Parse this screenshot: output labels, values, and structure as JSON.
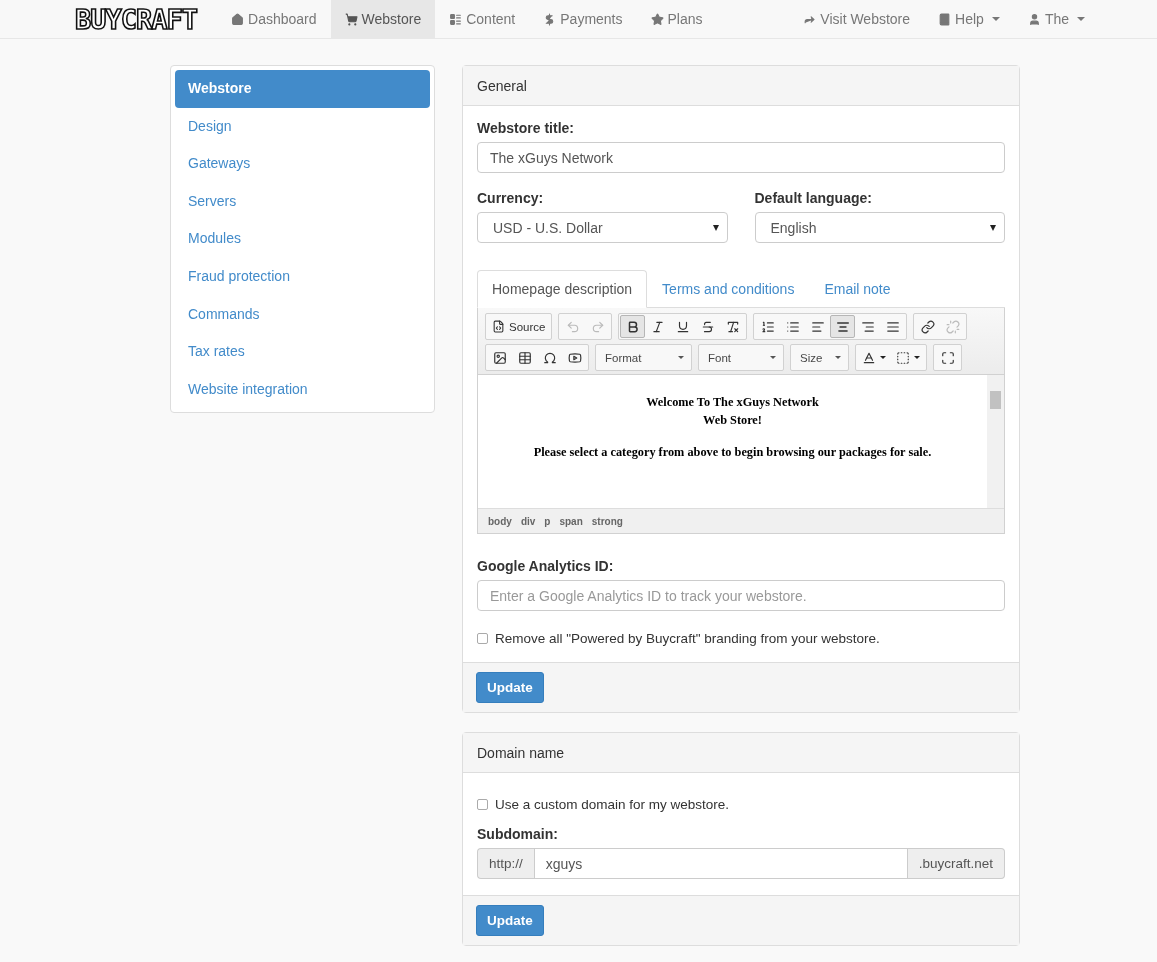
{
  "navbar": {
    "logo": "BUYCRAFT",
    "items": [
      {
        "label": "Dashboard",
        "selected": false
      },
      {
        "label": "Webstore",
        "selected": true
      },
      {
        "label": "Content",
        "selected": false
      },
      {
        "label": "Payments",
        "selected": false
      },
      {
        "label": "Plans",
        "selected": false
      }
    ],
    "right_items": [
      {
        "label": "Visit Webstore",
        "dropdown": false
      },
      {
        "label": "Help",
        "dropdown": true
      },
      {
        "label": "The",
        "dropdown": true
      }
    ]
  },
  "sidebar": {
    "items": [
      {
        "label": "Webstore",
        "selected": true
      },
      {
        "label": "Design",
        "selected": false
      },
      {
        "label": "Gateways",
        "selected": false
      },
      {
        "label": "Servers",
        "selected": false
      },
      {
        "label": "Modules",
        "selected": false
      },
      {
        "label": "Fraud protection",
        "selected": false
      },
      {
        "label": "Commands",
        "selected": false
      },
      {
        "label": "Tax rates",
        "selected": false
      },
      {
        "label": "Website integration",
        "selected": false
      }
    ]
  },
  "general_panel": {
    "title": "General",
    "webstore_title": {
      "label": "Webstore title:",
      "value": "The xGuys Network"
    },
    "currency": {
      "label": "Currency:",
      "value": "USD - U.S. Dollar"
    },
    "default_language": {
      "label": "Default language:",
      "value": "English"
    },
    "tabs": [
      {
        "label": "Homepage description",
        "selected": true
      },
      {
        "label": "Terms and conditions",
        "selected": false
      },
      {
        "label": "Email note",
        "selected": false
      }
    ],
    "editor": {
      "toolbar_rows": [
        [
          {
            "buttons": [
              {
                "kind": "text",
                "label": "Source",
                "selected": false,
                "disabled": false
              }
            ]
          },
          {
            "buttons": [
              {
                "kind": "icon",
                "selected": false,
                "disabled": true
              },
              {
                "kind": "icon",
                "selected": false,
                "disabled": true
              }
            ]
          },
          {
            "buttons": [
              {
                "kind": "icon",
                "selected": true,
                "disabled": false
              },
              {
                "kind": "icon",
                "selected": false,
                "disabled": false
              },
              {
                "kind": "icon",
                "selected": false,
                "disabled": false
              },
              {
                "kind": "icon",
                "selected": false,
                "disabled": false
              },
              {
                "kind": "icon",
                "selected": false,
                "disabled": false
              }
            ]
          },
          {
            "buttons": [
              {
                "kind": "icon",
                "selected": false,
                "disabled": false
              },
              {
                "kind": "icon",
                "selected": false,
                "disabled": false
              },
              {
                "kind": "icon",
                "selected": false,
                "disabled": false
              },
              {
                "kind": "icon",
                "selected": true,
                "disabled": false
              },
              {
                "kind": "icon",
                "selected": false,
                "disabled": false
              },
              {
                "kind": "icon",
                "selected": false,
                "disabled": false
              }
            ]
          },
          {
            "buttons": [
              {
                "kind": "icon",
                "selected": false,
                "disabled": false
              },
              {
                "kind": "icon",
                "selected": false,
                "disabled": true
              }
            ]
          }
        ],
        [
          {
            "buttons": [
              {
                "kind": "icon",
                "selected": false,
                "disabled": false
              },
              {
                "kind": "icon",
                "selected": false,
                "disabled": false
              },
              {
                "kind": "icon",
                "selected": false,
                "disabled": false
              },
              {
                "kind": "icon",
                "selected": false,
                "disabled": false
              }
            ]
          },
          {
            "buttons": [
              {
                "kind": "dropdown",
                "label": "Format"
              }
            ]
          },
          {
            "buttons": [
              {
                "kind": "dropdown",
                "label": "Font"
              }
            ]
          },
          {
            "buttons": [
              {
                "kind": "dropdown",
                "label": "Size"
              }
            ]
          },
          {
            "buttons": [
              {
                "kind": "color",
                "selected": false,
                "disabled": false
              },
              {
                "kind": "color",
                "selected": false,
                "disabled": false
              }
            ]
          },
          {
            "buttons": [
              {
                "kind": "icon",
                "selected": false,
                "disabled": false
              }
            ]
          }
        ]
      ],
      "paragraphs": [
        "Welcome To The xGuys Network\nWeb Store!",
        "Please select a category from above to begin browsing our packages for sale."
      ],
      "path": [
        "body",
        "div",
        "p",
        "span",
        "strong"
      ]
    },
    "analytics": {
      "label": "Google Analytics ID:",
      "placeholder": "Enter a Google Analytics ID to track your webstore."
    },
    "remove_branding": {
      "label": "Remove all \"Powered by Buycraft\" branding from your webstore.",
      "checked": false
    },
    "button": "Update"
  },
  "domain_panel": {
    "title": "Domain name",
    "custom_domain": {
      "label": "Use a custom domain for my webstore.",
      "checked": false
    },
    "subdomain": {
      "label": "Subdomain:",
      "prefix": "http://",
      "value": "xguys",
      "suffix": ".buycraft.net"
    },
    "button": "Update"
  }
}
